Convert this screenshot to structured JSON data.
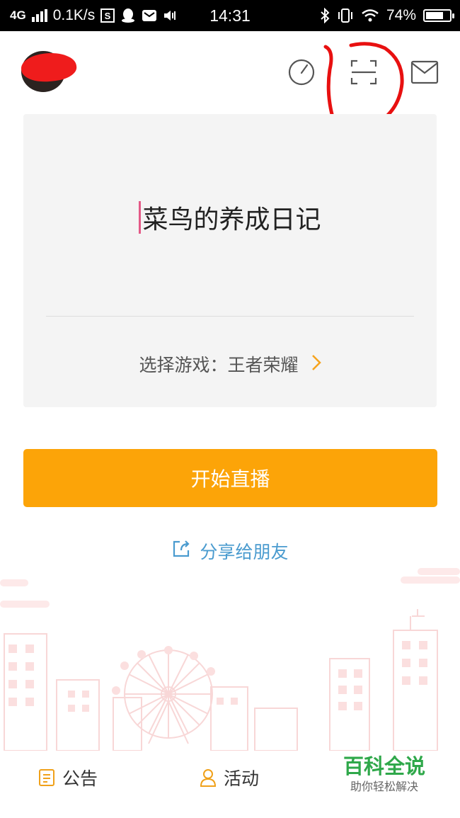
{
  "status_bar": {
    "network": "4G",
    "speed": "0.1K/s",
    "time": "14:31",
    "battery_text": "74%",
    "battery_level": 0.74
  },
  "header": {
    "icons": [
      "speed-gauge-icon",
      "scan-icon",
      "mail-icon"
    ]
  },
  "card": {
    "title_value": "菜鸟的养成日记",
    "game_label": "选择游戏：王者荣耀"
  },
  "start_button_label": "开始直播",
  "share_label": "分享给朋友",
  "bottom_nav": {
    "tabs": [
      {
        "label": "公告",
        "icon": "notice-icon"
      },
      {
        "label": "活动",
        "icon": "person-icon"
      }
    ]
  },
  "watermark": {
    "main": "百科全说",
    "sub": "助你轻松解决"
  },
  "colors": {
    "accent": "#fca408",
    "link": "#4a9bcf",
    "annotation": "#e81010",
    "watermark": "#2fa84a"
  }
}
